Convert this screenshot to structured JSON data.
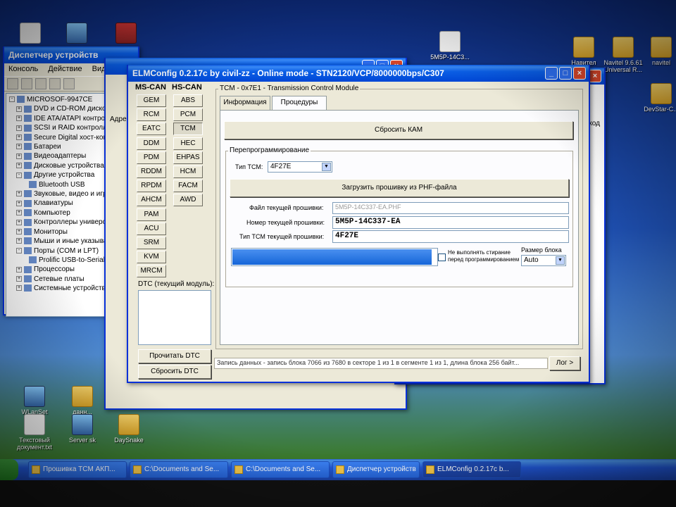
{
  "desktop": {
    "top_icons": [
      {
        "label": ""
      },
      {
        "label": ""
      },
      {
        "label": ""
      }
    ],
    "right_icons": [
      {
        "label": "5M5P-14C3..."
      },
      {
        "label": "Навител"
      },
      {
        "label": "Navitel 9.6.61 Universal R..."
      },
      {
        "label": "navitel"
      },
      {
        "label": "DevStar-C..."
      }
    ],
    "bottom_icons": [
      {
        "label": "WLanSet"
      },
      {
        "label": "данн..."
      },
      {
        "label": "Текстовый документ.txt"
      },
      {
        "label": "Server sk"
      },
      {
        "label": "DaySnake"
      }
    ]
  },
  "device_manager": {
    "title": "Диспетчер устройств",
    "menu": [
      "Консоль",
      "Действие",
      "Вид"
    ],
    "tree": [
      {
        "label": "MICROSOF-9947CE",
        "exp": "-"
      },
      {
        "label": "DVD и CD-ROM дисководы",
        "exp": "+"
      },
      {
        "label": "IDE ATA/ATAPI контроллеры",
        "exp": "+"
      },
      {
        "label": "SCSI и RAID контроллеры",
        "exp": "+"
      },
      {
        "label": "Secure Digital хост-контроллеры",
        "exp": "+"
      },
      {
        "label": "Батареи",
        "exp": "+"
      },
      {
        "label": "Видеоадаптеры",
        "exp": "+"
      },
      {
        "label": "Дисковые устройства",
        "exp": "+"
      },
      {
        "label": "Другие устройства",
        "exp": "-"
      },
      {
        "label": "Bluetooth USB",
        "exp": ""
      },
      {
        "label": "Звуковые, видео и игровые",
        "exp": "+"
      },
      {
        "label": "Клавиатуры",
        "exp": "+"
      },
      {
        "label": "Компьютер",
        "exp": "+"
      },
      {
        "label": "Контроллеры универсальной",
        "exp": "+"
      },
      {
        "label": "Мониторы",
        "exp": "+"
      },
      {
        "label": "Мыши и иные указывающие",
        "exp": "+"
      },
      {
        "label": "Порты (COM и LPT)",
        "exp": "-"
      },
      {
        "label": "Prolific USB-to-Serial",
        "exp": ""
      },
      {
        "label": "Процессоры",
        "exp": "+"
      },
      {
        "label": "Сетевые платы",
        "exp": "+"
      },
      {
        "label": "Системные устройства",
        "exp": "+"
      }
    ]
  },
  "behind_window": {
    "addr_label": "Адре",
    "right_label": "ход"
  },
  "elm": {
    "title": "ELMConfig 0.2.17c by civil-zz - Online mode - STN2120/VCP/8000000bps/C307",
    "ms_can_header": "MS-CAN",
    "hs_can_header": "HS-CAN",
    "ms_can_modules": [
      "GEM",
      "RCM",
      "EATC",
      "DDM",
      "PDM",
      "RDDM",
      "RPDM",
      "AHCM",
      "PAM",
      "ACU",
      "SRM",
      "KVM",
      "MRCM"
    ],
    "hs_can_modules": [
      "ABS",
      "PCM",
      "TCM",
      "HEC",
      "EHPAS",
      "HCM",
      "FACM",
      "AWD"
    ],
    "module_group_title": "TCM - 0x7E1 - Transmission Control Module",
    "tabs": [
      "Информация",
      "Процедуры"
    ],
    "reset_kam": "Сбросить КАМ",
    "reprog_title": "Перепрограммирование",
    "tcm_type_label": "Тип ТСМ:",
    "tcm_type_value": "4F27E",
    "load_btn": "Загрузить прошивку из PHF-файла",
    "fw_file_label": "Файл текущей прошивки:",
    "fw_file_value": "5M5P-14C337-EA.PHF",
    "fw_number_label": "Номер текущей прошивки:",
    "fw_number_value": "5M5P-14C337-EA",
    "fw_type_label": "Тип ТСМ текущей прошивки:",
    "fw_type_value": "4F27E",
    "progress_fraction": 0.97,
    "no_erase_label": "Не выполнять стирание перед программированием",
    "block_size_label": "Размер блока",
    "block_size_value": "Auto",
    "dtc_title": "DTC (текущий модуль):",
    "read_dtc": "Прочитать DTC",
    "clear_dtc": "Сбросить DTC",
    "status_text": "Запись данных - запись блока 7066 из 7680 в секторе 1 из 1 в сегменте 1 из 1, длина блока 256 байт...",
    "log_btn": "Лог >"
  },
  "taskbar": {
    "buttons": [
      {
        "label": "Прошивка TCM АКП..."
      },
      {
        "label": "C:\\Documents and Se..."
      },
      {
        "label": "C:\\Documents and Se..."
      },
      {
        "label": "Диспетчер устройств"
      },
      {
        "label": "ELMConfig 0.2.17c b..."
      }
    ]
  }
}
